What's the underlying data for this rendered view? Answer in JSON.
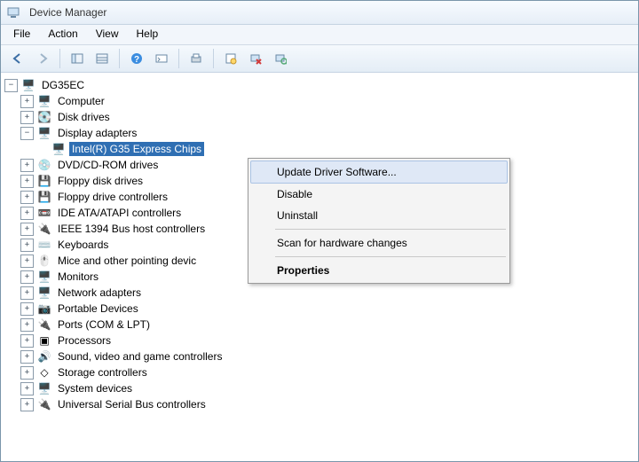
{
  "window": {
    "title": "Device Manager"
  },
  "menu": {
    "file": "File",
    "action": "Action",
    "view": "View",
    "help": "Help"
  },
  "toolbar_icons": [
    "back",
    "forward",
    "show-panel",
    "details",
    "help",
    "console",
    "print",
    "properties",
    "uninstall",
    "scan"
  ],
  "tree": {
    "root": {
      "label": "DG35EC",
      "expanded": true
    },
    "children": [
      {
        "id": "computer",
        "label": "Computer",
        "icon": "computer",
        "expanded": false
      },
      {
        "id": "disk-drives",
        "label": "Disk drives",
        "icon": "disk",
        "expanded": false
      },
      {
        "id": "display-adapters",
        "label": "Display adapters",
        "icon": "display",
        "expanded": true,
        "children": [
          {
            "id": "intel-g35",
            "label": "Intel(R)  G35 Express Chips",
            "icon": "display",
            "selected": true
          }
        ]
      },
      {
        "id": "dvd-cdrom",
        "label": "DVD/CD-ROM drives",
        "icon": "optical",
        "expanded": false
      },
      {
        "id": "floppy-disk",
        "label": "Floppy disk drives",
        "icon": "floppy",
        "expanded": false
      },
      {
        "id": "floppy-ctrl",
        "label": "Floppy drive controllers",
        "icon": "floppyctrl",
        "expanded": false
      },
      {
        "id": "ide-atapi",
        "label": "IDE ATA/ATAPI controllers",
        "icon": "ide",
        "expanded": false
      },
      {
        "id": "ieee1394",
        "label": "IEEE 1394 Bus host controllers",
        "icon": "1394",
        "expanded": false
      },
      {
        "id": "keyboards",
        "label": "Keyboards",
        "icon": "keyboard",
        "expanded": false
      },
      {
        "id": "mice",
        "label": "Mice and other pointing devic",
        "icon": "mouse",
        "expanded": false
      },
      {
        "id": "monitors",
        "label": "Monitors",
        "icon": "monitor",
        "expanded": false
      },
      {
        "id": "network",
        "label": "Network adapters",
        "icon": "network",
        "expanded": false
      },
      {
        "id": "portable",
        "label": "Portable Devices",
        "icon": "portable",
        "expanded": false
      },
      {
        "id": "ports",
        "label": "Ports (COM & LPT)",
        "icon": "port",
        "expanded": false
      },
      {
        "id": "processors",
        "label": "Processors",
        "icon": "cpu",
        "expanded": false
      },
      {
        "id": "sound",
        "label": "Sound, video and game controllers",
        "icon": "sound",
        "expanded": false
      },
      {
        "id": "storage",
        "label": "Storage controllers",
        "icon": "storage",
        "expanded": false
      },
      {
        "id": "system",
        "label": "System devices",
        "icon": "system",
        "expanded": false
      },
      {
        "id": "usb",
        "label": "Universal Serial Bus controllers",
        "icon": "usb",
        "expanded": false
      }
    ]
  },
  "context_menu": {
    "update": "Update Driver Software...",
    "disable": "Disable",
    "uninstall": "Uninstall",
    "scan": "Scan for hardware changes",
    "properties": "Properties"
  },
  "icons": {
    "computer": "🖥️",
    "disk": "💽",
    "display": "🖥️",
    "optical": "💿",
    "floppy": "💾",
    "floppyctrl": "💾",
    "ide": "📼",
    "1394": "🔌",
    "keyboard": "⌨️",
    "mouse": "🖱️",
    "monitor": "🖥️",
    "network": "🖥️",
    "portable": "📷",
    "port": "🔌",
    "cpu": "▣",
    "sound": "🔊",
    "storage": "◇",
    "system": "🖥️",
    "usb": "🔌",
    "root": "🖥️"
  }
}
